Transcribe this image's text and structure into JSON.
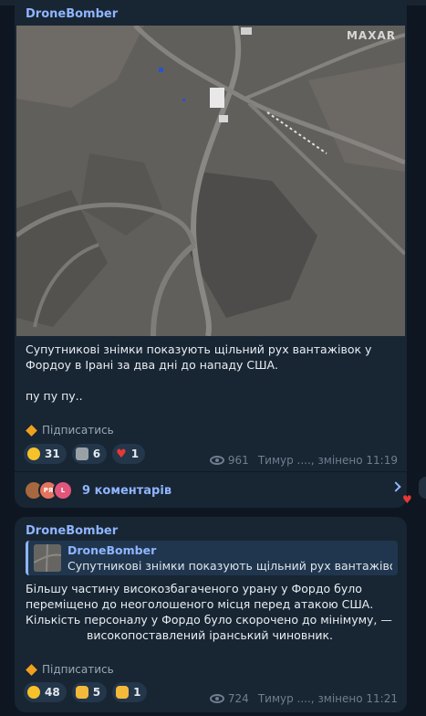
{
  "post1": {
    "sender": "DroneBomber",
    "image_watermark": "MAXAR",
    "text_line1": "Супутникові знімки показують щільний рух вантажівок у",
    "text_line2": "Фордоу в Ірані за два дні до нападу США.",
    "text_line3": "пу пу пу..",
    "subscribe": "Підписатись",
    "reactions": [
      {
        "icon": "grinning-face-emoji",
        "count": "31"
      },
      {
        "icon": "moai-emoji",
        "count": "6"
      },
      {
        "icon": "red-heart-emoji",
        "count": "1"
      }
    ],
    "views": "961",
    "author_meta": "Тимур ...., змінено 11:19",
    "comment_avatars": [
      "РЯ",
      "L"
    ],
    "comments": "9 коментарів"
  },
  "post2": {
    "sender": "DroneBomber",
    "quote_name": "DroneBomber",
    "quote_text": "Супутникові знімки показують щільний рух вантажіво...",
    "text_line1": "Більшу частину високозбагаченого урану у Фордо було",
    "text_line2": "переміщено до неоголошеного місця перед атакою США.",
    "text_line3": "Кількість персоналу у Фордо було скорочено до мінімуму, —",
    "text_line4": "високопоставлений іранський чиновник.",
    "subscribe": "Підписатись",
    "reactions": [
      {
        "icon": "grinning-face-emoji",
        "count": "48"
      },
      {
        "icon": "thumbs-up-emoji",
        "count": "5"
      },
      {
        "icon": "folded-hands-emoji",
        "count": "1"
      }
    ],
    "views": "724",
    "author_meta": "Тимур ...., змінено 11:21"
  },
  "colors": {
    "background": "#0e1621",
    "bubble": "#182533",
    "accent": "#8fb5ff",
    "reaction_bg": "#23364a"
  }
}
